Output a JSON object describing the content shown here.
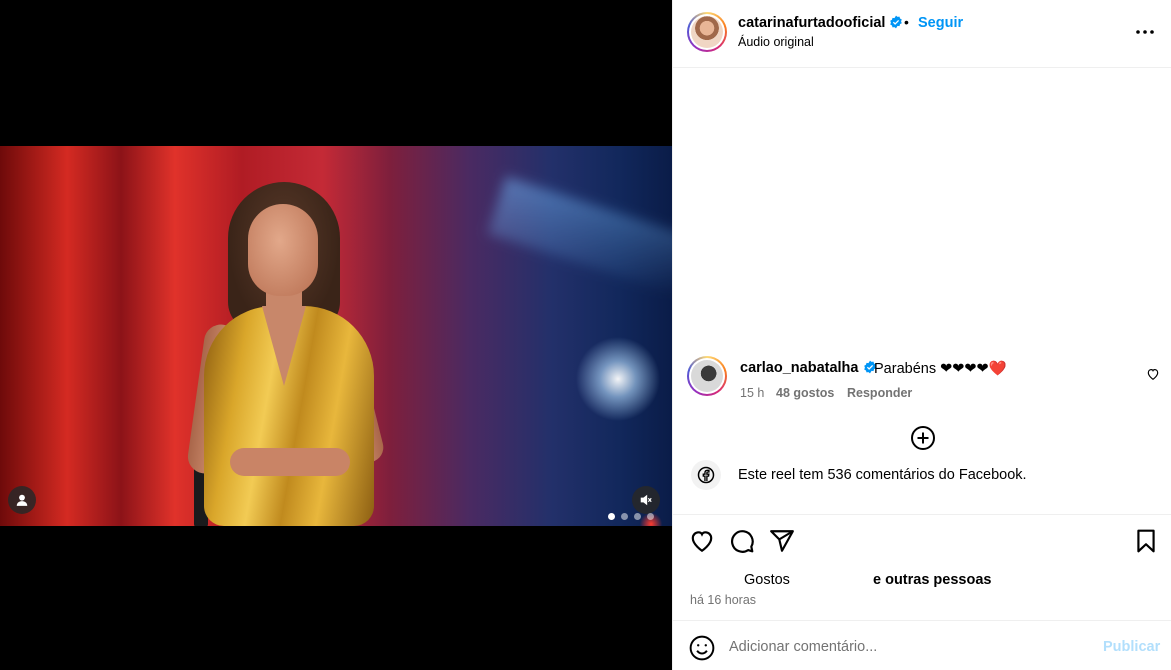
{
  "post": {
    "username": "catarinafurtadooficial",
    "separator": "•",
    "follow_label": "Seguir",
    "audio_label": "Áudio original",
    "more_icon": "more-horizontal-icon"
  },
  "comment": {
    "username": "carlao_nabatalha",
    "text": "Parabéns ❤❤❤❤❤️",
    "time": "15 h",
    "likes": "48 gostos",
    "reply_label": "Responder"
  },
  "facebook_notice": {
    "text": "Este reel tem 536 comentários do Facebook."
  },
  "actions": {
    "likes_label": "Gostos",
    "likes_others": "e outras pessoas",
    "time_ago": "há 16 horas"
  },
  "composer": {
    "placeholder": "Adicionar comentário...",
    "publish_label": "Publicar"
  },
  "media": {
    "carousel_count": 4,
    "carousel_active": 1
  },
  "colors": {
    "accent": "#0095f6",
    "publish_disabled": "#b2dffc",
    "secondary_text": "#737373",
    "divider": "#efefef"
  }
}
